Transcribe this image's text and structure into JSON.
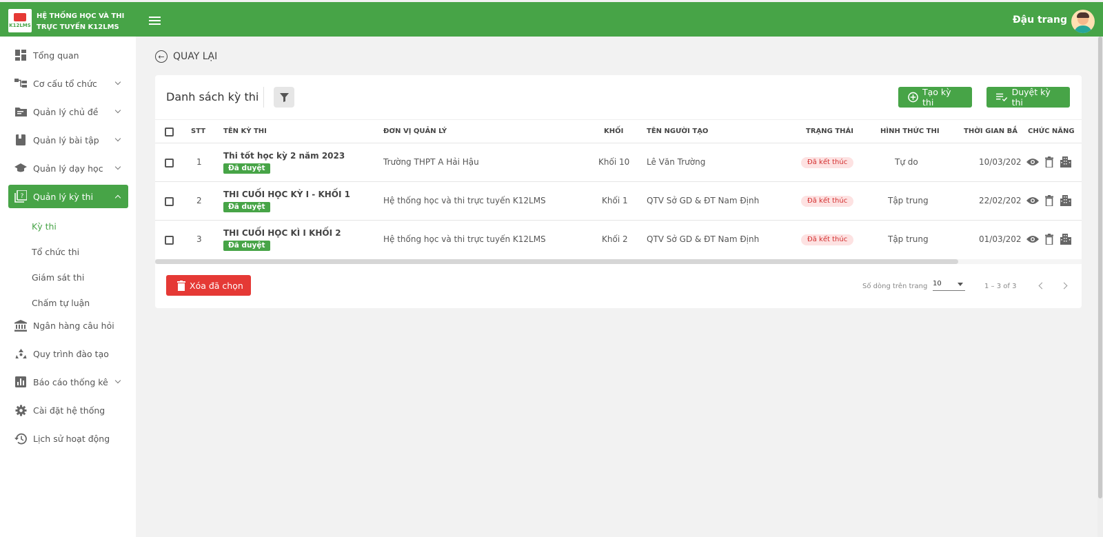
{
  "header": {
    "brand_line1": "HỆ THỐNG HỌC VÀ THI",
    "brand_line2": "TRỰC TUYẾN K12LMS",
    "logo_text": "K12LMS",
    "user_name": "Đậu trang",
    "color": "#47a447"
  },
  "sidebar": {
    "items": [
      {
        "label": "Tổng quan",
        "icon": "dashboard-icon"
      },
      {
        "label": "Cơ cấu tổ chức",
        "icon": "org-tree-icon"
      },
      {
        "label": "Quản lý chủ đề",
        "icon": "folder-icon"
      },
      {
        "label": "Quản lý bài tập",
        "icon": "book-icon"
      },
      {
        "label": "Quản lý dạy học",
        "icon": "graduation-cap-icon"
      },
      {
        "label": "Quản lý kỳ thi",
        "icon": "quiz-icon"
      },
      {
        "label": "Ngân hàng câu hỏi",
        "icon": "bank-icon"
      },
      {
        "label": "Quy trình đào tạo",
        "icon": "recycle-icon"
      },
      {
        "label": "Báo cáo thống kê",
        "icon": "bar-chart-icon"
      },
      {
        "label": "Cài đặt hệ thống",
        "icon": "gear-icon"
      },
      {
        "label": "Lịch sử hoạt động",
        "icon": "history-icon"
      }
    ],
    "sub_items": [
      {
        "label": "Kỳ thi"
      },
      {
        "label": "Tổ chức thi"
      },
      {
        "label": "Giám sát thi"
      },
      {
        "label": "Chấm tự luận"
      }
    ]
  },
  "main": {
    "back_label": "QUAY LẠI",
    "card_title": "Danh sách kỳ thi",
    "create_label": "Tạo kỳ thi",
    "review_label": "Duyệt kỳ thi",
    "delete_label": "Xóa đã chọn",
    "rows_per_page_label": "Số dòng trên trang",
    "rows_per_page_value": "10",
    "range_label": "1 – 3 of 3"
  },
  "table": {
    "headers": [
      "STT",
      "TÊN KỲ THI",
      "ĐƠN VỊ QUẢN LÝ",
      "KHỐI",
      "TÊN NGƯỜI TẠO",
      "TRẠNG THÁI",
      "HÌNH THỨC THI",
      "THỜI GIAN BẮ",
      "CHỨC NĂNG"
    ],
    "rows": [
      {
        "stt": "1",
        "name": "Thi tốt học kỳ 2 năm 2023",
        "badge": "Đã duyệt",
        "unit": "Trường THPT A Hải Hậu",
        "grade": "Khối 10",
        "creator": "Lê Văn Trường",
        "status": "Đã kết thúc",
        "mode": "Tự do",
        "time": "10/03/202"
      },
      {
        "stt": "2",
        "name": "THI CUỐI HỌC KỲ I - KHỐI 1",
        "badge": "Đã duyệt",
        "unit": "Hệ thống học và thi trực tuyến K12LMS",
        "grade": "Khối 1",
        "creator": "QTV Sở GD & ĐT Nam Định",
        "status": "Đã kết thúc",
        "mode": "Tập trung",
        "time": "22/02/202"
      },
      {
        "stt": "3",
        "name": "THI CUỐI HỌC KÌ I KHỐI 2",
        "badge": "Đã duyệt",
        "unit": "Hệ thống học và thi trực tuyến K12LMS",
        "grade": "Khối 2",
        "creator": "QTV Sở GD & ĐT Nam Định",
        "status": "Đã kết thúc",
        "mode": "Tập trung",
        "time": "01/03/202"
      }
    ]
  }
}
